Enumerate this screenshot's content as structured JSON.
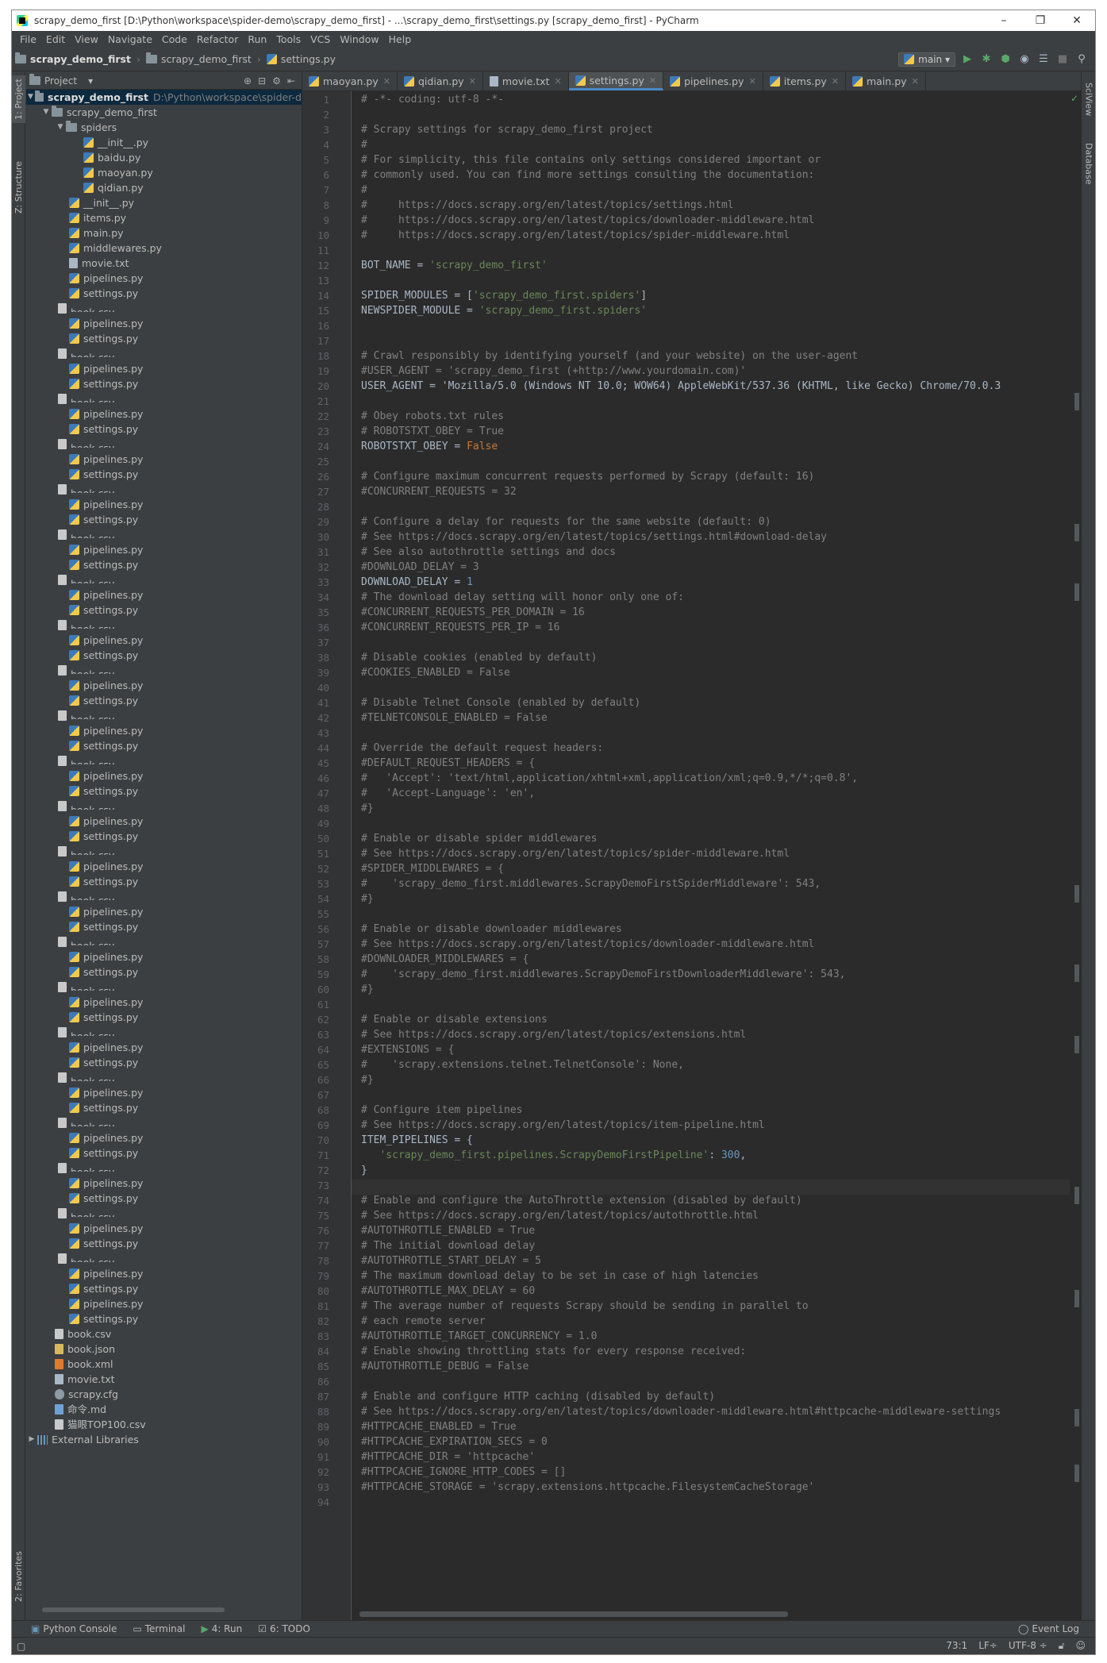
{
  "window": {
    "title": "scrapy_demo_first [D:\\Python\\workspace\\spider-demo\\scrapy_demo_first] - ...\\scrapy_demo_first\\settings.py [scrapy_demo_first] - PyCharm",
    "minimize": "–",
    "maximize": "❐",
    "close": "✕"
  },
  "menu": [
    "File",
    "Edit",
    "View",
    "Navigate",
    "Code",
    "Refactor",
    "Run",
    "Tools",
    "VCS",
    "Window",
    "Help"
  ],
  "breadcrumb": {
    "project": "scrapy_demo_first",
    "folder": "scrapy_demo_first",
    "file": "settings.py"
  },
  "run_config": {
    "name": "main",
    "arrow": "▾"
  },
  "toolbar_icons": [
    "run-icon",
    "debug-icon",
    "coverage-icon",
    "profile-icon",
    "concurrency-icon",
    "stop-icon",
    "search-icon"
  ],
  "left_tabs": {
    "project": "1: Project",
    "structure": "Z: Structure",
    "favorites": "2: Favorites"
  },
  "right_tabs": {
    "sciview": "SciView",
    "database": "Database"
  },
  "project_panel": {
    "title": "Project",
    "dropdown": "▾"
  },
  "tree": {
    "root": "scrapy_demo_first",
    "root_path": "D:\\Python\\workspace\\spider-d",
    "pkg": "scrapy_demo_first",
    "spiders": "spiders",
    "spider_files": [
      "__init__.py",
      "baidu.py",
      "maoyan.py",
      "qidian.py"
    ],
    "pkg_files": [
      "__init__.py",
      "items.py",
      "main.py",
      "middlewares.py",
      "movie.txt",
      "pipelines.py",
      "settings.py"
    ],
    "repeat_group": "book.csv",
    "repeat_a": "pipelines.py",
    "repeat_b": "settings.py",
    "tail_a": "pipelines.py",
    "tail_b": "settings.py",
    "root_files": [
      "book.csv",
      "book.json",
      "book.xml",
      "movie.txt",
      "scrapy.cfg",
      "命令.md",
      "猫眼TOP100.csv"
    ],
    "external": "External Libraries"
  },
  "tabs": [
    "maoyan.py",
    "qidian.py",
    "movie.txt",
    "settings.py",
    "pipelines.py",
    "items.py",
    "main.py"
  ],
  "active_tab": "settings.py",
  "code_lines": [
    "# -*- coding: utf-8 -*-",
    "",
    "# Scrapy settings for scrapy_demo_first project",
    "#",
    "# For simplicity, this file contains only settings considered important or",
    "# commonly used. You can find more settings consulting the documentation:",
    "#",
    "#     https://docs.scrapy.org/en/latest/topics/settings.html",
    "#     https://docs.scrapy.org/en/latest/topics/downloader-middleware.html",
    "#     https://docs.scrapy.org/en/latest/topics/spider-middleware.html",
    "",
    "BOT_NAME = 'scrapy_demo_first'",
    "",
    "SPIDER_MODULES = ['scrapy_demo_first.spiders']",
    "NEWSPIDER_MODULE = 'scrapy_demo_first.spiders'",
    "",
    "",
    "# Crawl responsibly by identifying yourself (and your website) on the user-agent",
    "#USER_AGENT = 'scrapy_demo_first (+http://www.yourdomain.com)'",
    "USER_AGENT = 'Mozilla/5.0 (Windows NT 10.0; WOW64) AppleWebKit/537.36 (KHTML, like Gecko) Chrome/70.0.3",
    "",
    "# Obey robots.txt rules",
    "# ROBOTSTXT_OBEY = True",
    "ROBOTSTXT_OBEY = False",
    "",
    "# Configure maximum concurrent requests performed by Scrapy (default: 16)",
    "#CONCURRENT_REQUESTS = 32",
    "",
    "# Configure a delay for requests for the same website (default: 0)",
    "# See https://docs.scrapy.org/en/latest/topics/settings.html#download-delay",
    "# See also autothrottle settings and docs",
    "#DOWNLOAD_DELAY = 3",
    "DOWNLOAD_DELAY = 1",
    "# The download delay setting will honor only one of:",
    "#CONCURRENT_REQUESTS_PER_DOMAIN = 16",
    "#CONCURRENT_REQUESTS_PER_IP = 16",
    "",
    "# Disable cookies (enabled by default)",
    "#COOKIES_ENABLED = False",
    "",
    "# Disable Telnet Console (enabled by default)",
    "#TELNETCONSOLE_ENABLED = False",
    "",
    "# Override the default request headers:",
    "#DEFAULT_REQUEST_HEADERS = {",
    "#   'Accept': 'text/html,application/xhtml+xml,application/xml;q=0.9,*/*;q=0.8',",
    "#   'Accept-Language': 'en',",
    "#}",
    "",
    "# Enable or disable spider middlewares",
    "# See https://docs.scrapy.org/en/latest/topics/spider-middleware.html",
    "#SPIDER_MIDDLEWARES = {",
    "#    'scrapy_demo_first.middlewares.ScrapyDemoFirstSpiderMiddleware': 543,",
    "#}",
    "",
    "# Enable or disable downloader middlewares",
    "# See https://docs.scrapy.org/en/latest/topics/downloader-middleware.html",
    "#DOWNLOADER_MIDDLEWARES = {",
    "#    'scrapy_demo_first.middlewares.ScrapyDemoFirstDownloaderMiddleware': 543,",
    "#}",
    "",
    "# Enable or disable extensions",
    "# See https://docs.scrapy.org/en/latest/topics/extensions.html",
    "#EXTENSIONS = {",
    "#    'scrapy.extensions.telnet.TelnetConsole': None,",
    "#}",
    "",
    "# Configure item pipelines",
    "# See https://docs.scrapy.org/en/latest/topics/item-pipeline.html",
    "ITEM_PIPELINES = {",
    "   'scrapy_demo_first.pipelines.ScrapyDemoFirstPipeline': 300,",
    "}",
    "",
    "# Enable and configure the AutoThrottle extension (disabled by default)",
    "# See https://docs.scrapy.org/en/latest/topics/autothrottle.html",
    "#AUTOTHROTTLE_ENABLED = True",
    "# The initial download delay",
    "#AUTOTHROTTLE_START_DELAY = 5",
    "# The maximum download delay to be set in case of high latencies",
    "#AUTOTHROTTLE_MAX_DELAY = 60",
    "# The average number of requests Scrapy should be sending in parallel to",
    "# each remote server",
    "#AUTOTHROTTLE_TARGET_CONCURRENCY = 1.0",
    "# Enable showing throttling stats for every response received:",
    "#AUTOTHROTTLE_DEBUG = False",
    "",
    "# Enable and configure HTTP caching (disabled by default)",
    "# See https://docs.scrapy.org/en/latest/topics/downloader-middleware.html#httpcache-middleware-settings",
    "#HTTPCACHE_ENABLED = True",
    "#HTTPCACHE_EXPIRATION_SECS = 0",
    "#HTTPCACHE_DIR = 'httpcache'",
    "#HTTPCACHE_IGNORE_HTTP_CODES = []",
    "#HTTPCACHE_STORAGE = 'scrapy.extensions.httpcache.FilesystemCacheStorage'",
    ""
  ],
  "bottom_tools": [
    "Python Console",
    "Terminal",
    "4: Run",
    "6: TODO"
  ],
  "event_log": "Event Log",
  "status": {
    "position": "73:1",
    "line_sep": "LF÷",
    "encoding": "UTF-8 ÷"
  },
  "colors": {
    "bg": "#2b2b2b",
    "panel": "#3c3f41",
    "comment": "#808080",
    "string": "#6a8759",
    "keyword": "#cc7832",
    "number": "#6897bb",
    "selection": "#0d293e"
  }
}
